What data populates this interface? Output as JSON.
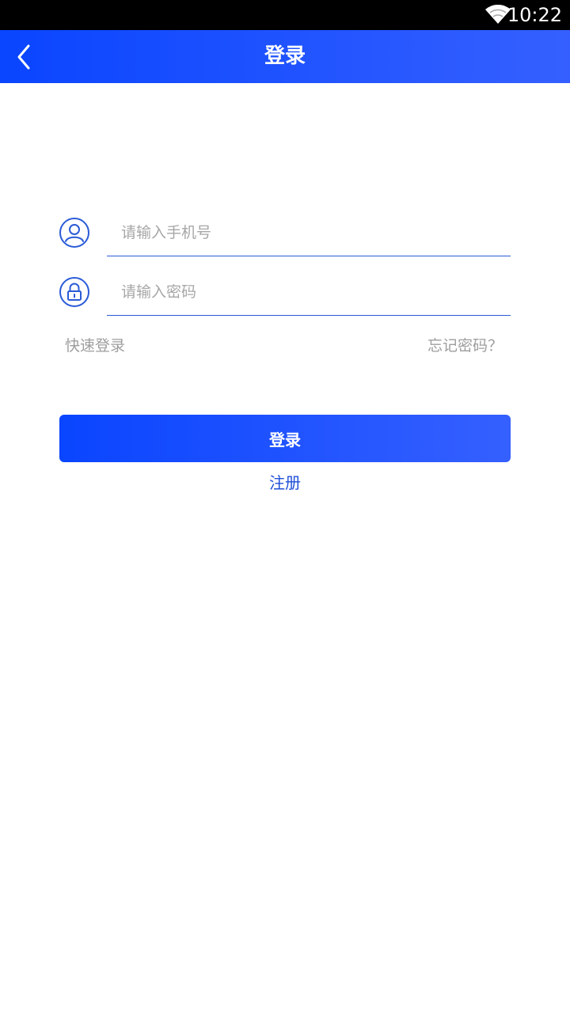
{
  "status_bar": {
    "time": "10:22",
    "wifi_icon": "wifi-icon"
  },
  "app_bar": {
    "title": "登录",
    "back_icon": "chevron-left-icon"
  },
  "form": {
    "phone": {
      "value": "",
      "placeholder": "请输入手机号",
      "icon": "user-icon"
    },
    "password": {
      "value": "",
      "placeholder": "请输入密码",
      "icon": "lock-icon"
    },
    "quick_login_label": "快速登录",
    "forgot_password_label": "忘记密码？",
    "login_label": "登录",
    "register_label": "注册"
  },
  "colors": {
    "accent": "#0a45ff",
    "accent_end": "#3560ff",
    "link": "#1f4fd8",
    "hint": "#9e9e9e"
  }
}
